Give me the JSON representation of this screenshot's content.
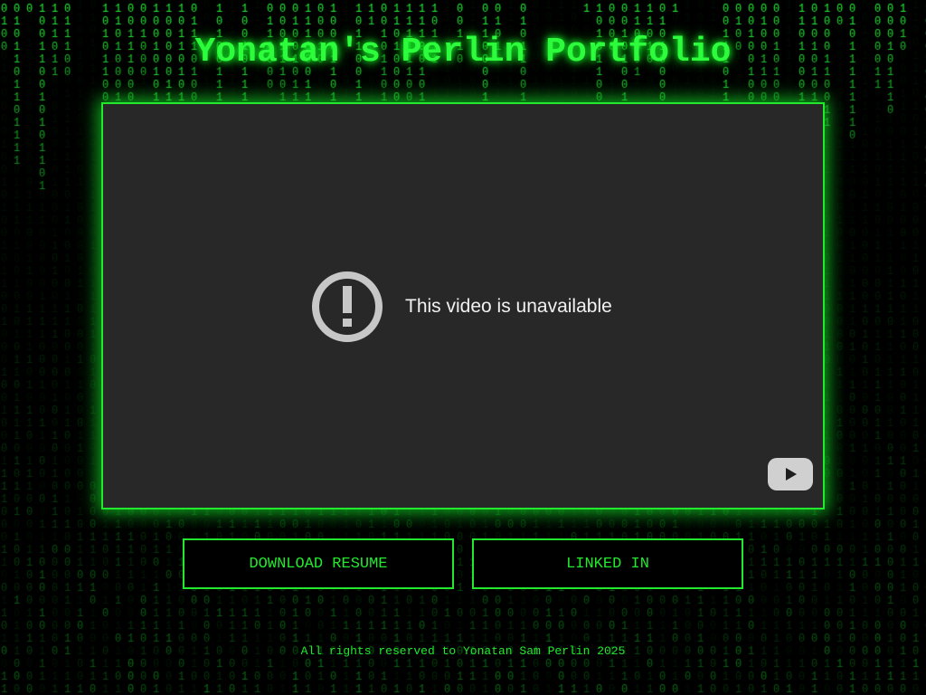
{
  "page": {
    "title": "Yonatan's Perlin Portfolio",
    "footer": "All rights reserved to Yonatan Sam Perlin 2025"
  },
  "video": {
    "message": "This video is unavailable",
    "error_icon": "exclamation-circle-icon",
    "logo_icon": "youtube-play-icon"
  },
  "buttons": {
    "resume_label": "DOWNLOAD RESUME",
    "linkedin_label": "LINKED IN"
  },
  "background": {
    "effect": "matrix binary rain",
    "characters": "01"
  },
  "colors": {
    "accent": "#22e82e",
    "title": "#2dfc3c",
    "background": "#000000",
    "video_bg": "#282828",
    "icon_gray": "#c7c7c7"
  }
}
